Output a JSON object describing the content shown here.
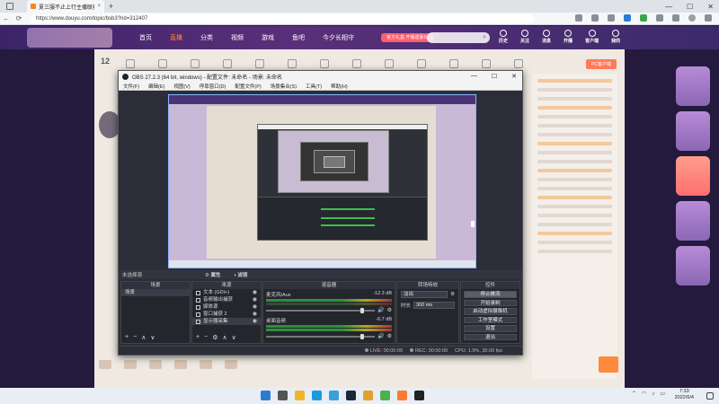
{
  "browser": {
    "tab_title": "夏三服不止上行主播联赛",
    "tab_close": "×",
    "new_tab": "+",
    "url": "https://www.douyu.com/topic/bsb3?rid=312407",
    "window_controls": [
      "—",
      "☐",
      "✕"
    ],
    "nav": [
      "←",
      "⟳"
    ]
  },
  "site": {
    "nav_items": [
      "首页",
      "直播",
      "分类",
      "视频",
      "游戏",
      "鱼吧",
      "今夕长相守"
    ],
    "active_index": 1,
    "promo_label": "官方礼盒\n开播送豪礼",
    "header_icons": [
      "历史",
      "关注",
      "消息",
      "开播",
      "客户端",
      "我的"
    ],
    "date": "12",
    "pink_button": "PC客户端"
  },
  "obs": {
    "title": "OBS 27.2.3 (64 bit, windows) - 配置文件: 未命名 - 场景: 未命名",
    "menu": [
      "文件(F)",
      "编辑(E)",
      "视图(V)",
      "停靠窗口(D)",
      "配置文件(P)",
      "场景集合(S)",
      "工具(T)",
      "帮助(H)"
    ],
    "window_controls": [
      "—",
      "☐",
      "✕"
    ],
    "props_bar": {
      "no_source": "未选择源",
      "properties": "属性",
      "filters": "滤镜"
    },
    "scenes": {
      "header": "场景",
      "items": [
        "场景"
      ]
    },
    "sources": {
      "header": "来源",
      "items": [
        "文本 (GDI+)",
        "音频输出捕获",
        "媒体源",
        "窗口捕获 2",
        "显示器采集"
      ]
    },
    "mixer": {
      "header": "混音器",
      "channels": [
        {
          "name": "麦克风/Aux",
          "db": "-12.3 dB"
        },
        {
          "name": "桌面音频",
          "db": "-6.7 dB"
        }
      ]
    },
    "transitions": {
      "header": "转场特效",
      "type": "淡出",
      "duration_label": "时长",
      "duration": "300 ms"
    },
    "controls": {
      "header": "控件",
      "buttons": [
        "停止推流",
        "开始录制",
        "启动虚拟摄像机",
        "工作室模式",
        "设置",
        "退出"
      ]
    },
    "status": {
      "live_label": "LIVE:",
      "live_time": "00:00:00",
      "rec_label": "REC:",
      "rec_time": "00:00:00",
      "cpu": "CPU: 1.9%, 30.00 fps"
    },
    "dock_buttons": [
      "+",
      "−",
      "∧",
      "∨"
    ],
    "source_buttons": [
      "+",
      "−",
      "⚙",
      "∧",
      "∨"
    ]
  },
  "taskbar": {
    "time": "7:33",
    "date": "2022/6/4",
    "apps": [
      {
        "name": "start-icon",
        "color": "#2b7cd3"
      },
      {
        "name": "search-icon",
        "color": "#555555"
      },
      {
        "name": "file-explorer-icon",
        "color": "#f0b429"
      },
      {
        "name": "edge-icon",
        "color": "#1c9bd8"
      },
      {
        "name": "media-icon",
        "color": "#3aa0d8"
      },
      {
        "name": "steam-icon",
        "color": "#1b2838"
      },
      {
        "name": "mail-icon",
        "color": "#e0a22a"
      },
      {
        "name": "game-icon",
        "color": "#4caf50"
      },
      {
        "name": "douyu-icon",
        "color": "#ff7a30"
      },
      {
        "name": "obs-icon",
        "color": "#222222"
      }
    ]
  }
}
